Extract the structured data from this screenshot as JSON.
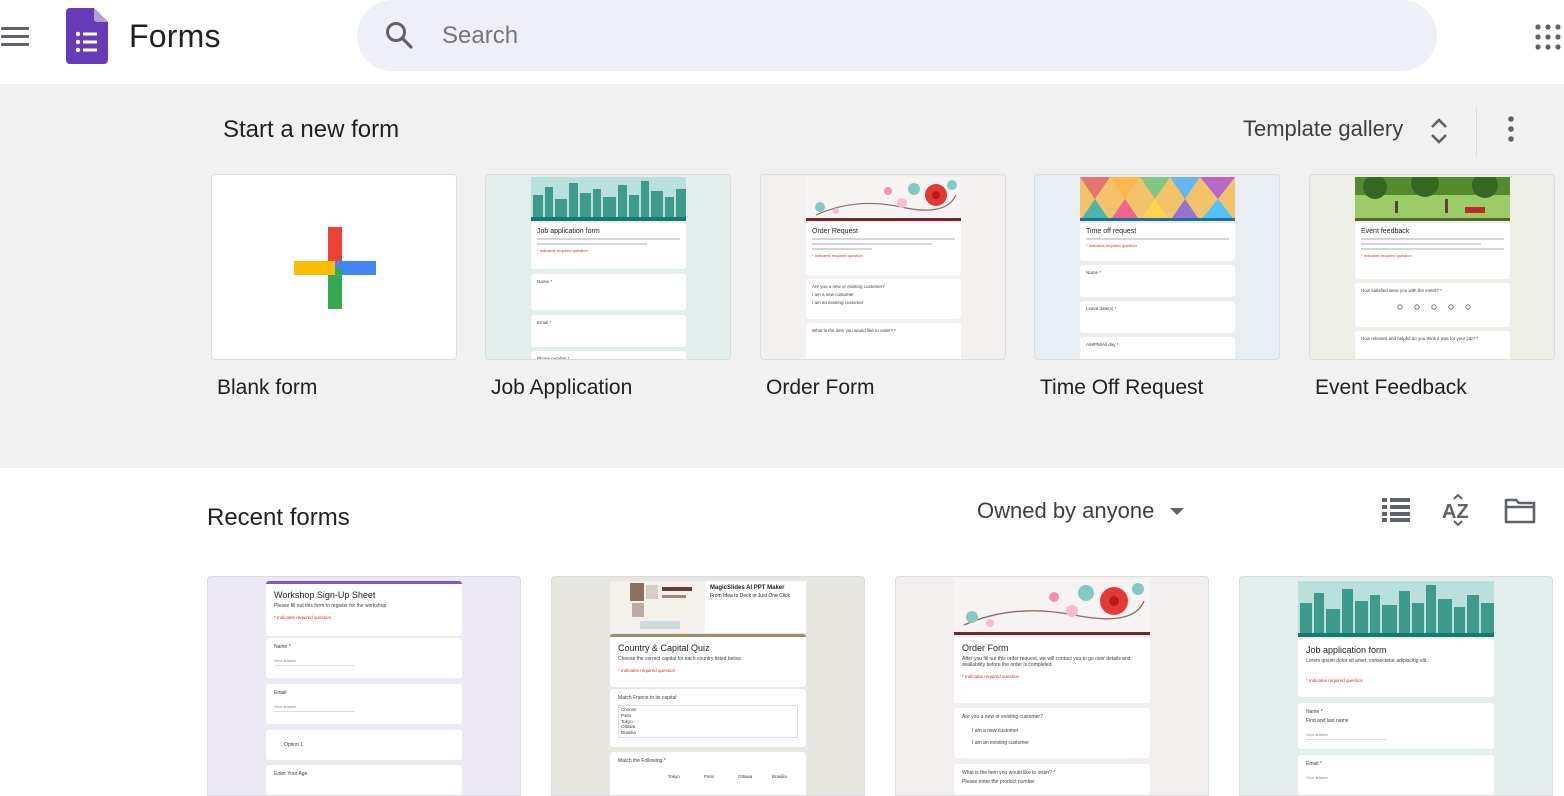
{
  "header": {
    "app_title": "Forms",
    "search_placeholder": "Search",
    "colors": {
      "brand": "#673ab7",
      "search_bg": "#edf1f7",
      "icon": "#5f6368"
    }
  },
  "templates": {
    "section_title": "Start a new form",
    "gallery_label": "Template gallery",
    "items": [
      {
        "label": "Blank form"
      },
      {
        "label": "Job Application",
        "preview_title": "Job application form",
        "preview_fields": [
          "Name *",
          "Email *",
          "Phone number *"
        ]
      },
      {
        "label": "Order Form",
        "preview_title": "Order Request",
        "preview_fields": [
          "Are you a new or existing customer?",
          "I am a new customer",
          "I am an existing customer",
          "What is the item you would like to order? *"
        ]
      },
      {
        "label": "Time Off Request",
        "preview_title": "Time off request",
        "preview_fields": [
          "Name *",
          "Leave date(s) *",
          "AM/PM/All day *"
        ]
      },
      {
        "label": "Event Feedback",
        "preview_title": "Event feedback",
        "preview_fields": [
          "How satisfied were you with the event? *",
          "How relevant and helpful do you think it was for your job? *"
        ]
      }
    ],
    "colors": {
      "section_bg": "#f1f1f1",
      "plus_red": "#ea4335",
      "plus_blue": "#4285f4",
      "plus_yellow": "#fbbc04",
      "plus_green": "#34a853"
    }
  },
  "recent": {
    "section_title": "Recent forms",
    "owner_filter": "Owned by anyone",
    "items": [
      {
        "title": "Workshop Sign-Up Sheet",
        "description": "Please fill out this form to register for the workshop",
        "required_note": "* Indicates required question",
        "fields": [
          "Name *",
          "Email",
          "Option 1",
          "Enter Your Age"
        ],
        "answer": "Your answer",
        "accent": "#7e57c2",
        "bg": "#ece8f6"
      },
      {
        "title": "Country & Capital Quiz",
        "description": "Choose the correct capital for each country listed below",
        "required_note": "* Indicates required question",
        "banner_title": "MagicSlides AI PPT Maker",
        "banner_sub": "From Idea to Deck in Just One Click",
        "fields": [
          "Match France to its capital",
          "Choose",
          "Paris",
          "Tokyo",
          "Ottawa",
          "Brasilia",
          "Match the Following *"
        ],
        "columns": [
          "Tokyo",
          "Paris",
          "Ottawa",
          "Brasilia"
        ],
        "accent": "#a08c6c",
        "bg": "#e8e6e1"
      },
      {
        "title": "Order Form",
        "description": "After you fill out this order request, we will contact you to go over details and availability before the order is completed.",
        "required_note": "* Indicates required question",
        "fields": [
          "Are you a new or existing customer?",
          "I am a new customer",
          "I am an existing customer",
          "What is the item you would like to order? *",
          "Please enter the product number"
        ],
        "accent": "#6d2b2b",
        "bg": "#f3eeee"
      },
      {
        "title": "Job application form",
        "description": "Lorem ipsum dolor sit amet, consectetur adipiscing elit.",
        "required_note": "* Indicates required question",
        "fields": [
          "Name *",
          "First and last name",
          "Email *"
        ],
        "answer": "Your answer",
        "accent": "#137a6d",
        "bg": "#e4eeec"
      }
    ]
  }
}
